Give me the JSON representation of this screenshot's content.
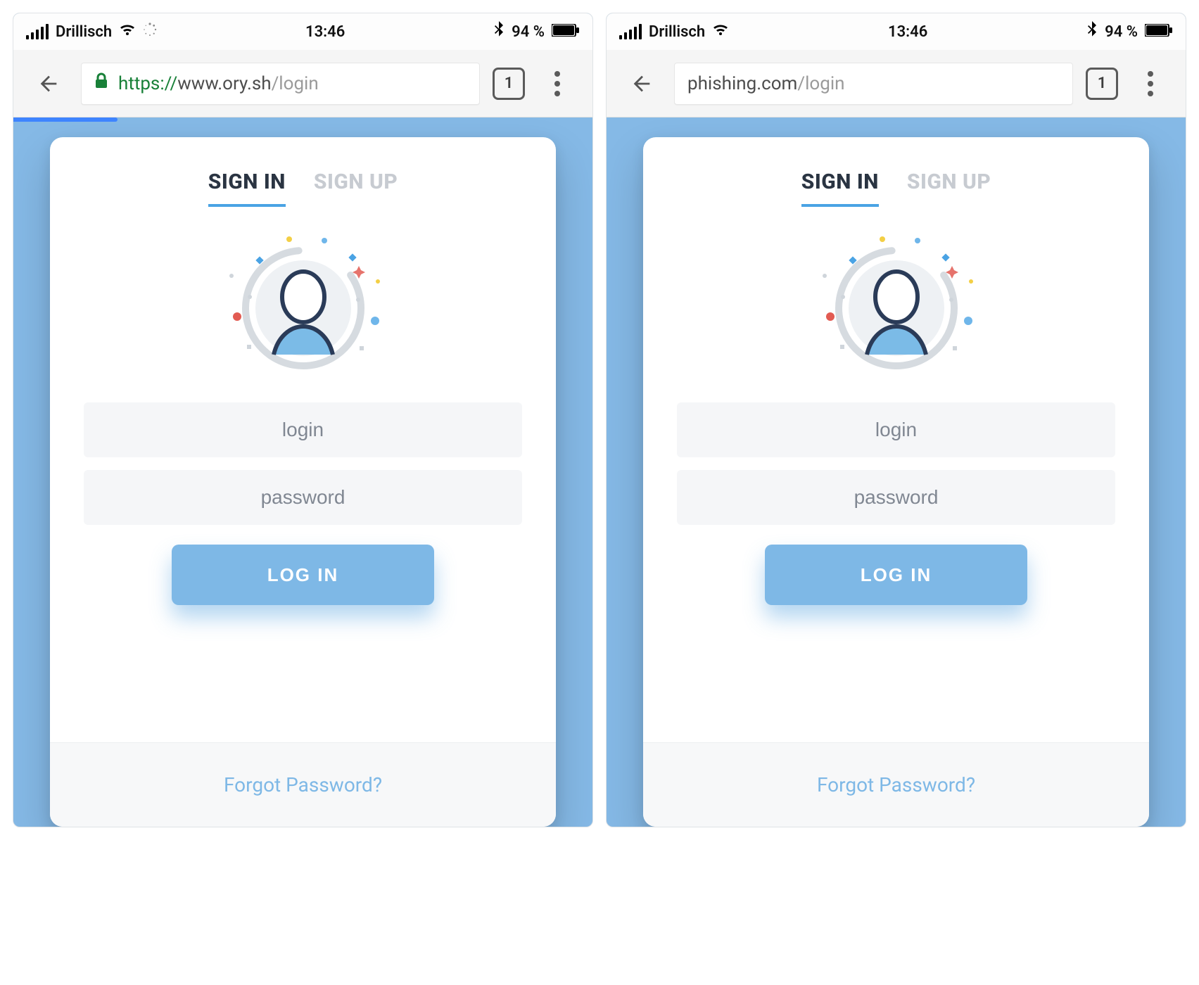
{
  "panes": [
    {
      "status": {
        "carrier": "Drillisch",
        "time": "13:46",
        "battery_pct": "94 %"
      },
      "toolbar": {
        "has_lock": true,
        "scheme": "https://",
        "host": "www.ory.sh",
        "path": "/login",
        "plain_url": "",
        "tab_count": "1",
        "progress_pct": 18
      },
      "login": {
        "tabs": {
          "signin": "SIGN IN",
          "signup": "SIGN UP",
          "active": "signin"
        },
        "fields": {
          "login_placeholder": "login",
          "password_placeholder": "password"
        },
        "submit_label": "LOG IN",
        "forgot_label": "Forgot Password?"
      }
    },
    {
      "status": {
        "carrier": "Drillisch",
        "time": "13:46",
        "battery_pct": "94 %"
      },
      "toolbar": {
        "has_lock": false,
        "scheme": "",
        "host": "phishing.com",
        "path": "/login",
        "plain_url": "",
        "tab_count": "1",
        "progress_pct": 0
      },
      "login": {
        "tabs": {
          "signin": "SIGN IN",
          "signup": "SIGN UP",
          "active": "signin"
        },
        "fields": {
          "login_placeholder": "login",
          "password_placeholder": "password"
        },
        "submit_label": "LOG IN",
        "forgot_label": "Forgot Password?"
      }
    }
  ],
  "icons": {
    "back": "back-arrow-icon",
    "lock": "lock-icon",
    "tabs": "tabs-count-icon",
    "menu": "kebab-menu-icon",
    "wifi": "wifi-icon",
    "loading": "loading-spinner-icon",
    "bluetooth": "bluetooth-icon",
    "battery": "battery-icon",
    "avatar": "user-avatar-icon"
  }
}
